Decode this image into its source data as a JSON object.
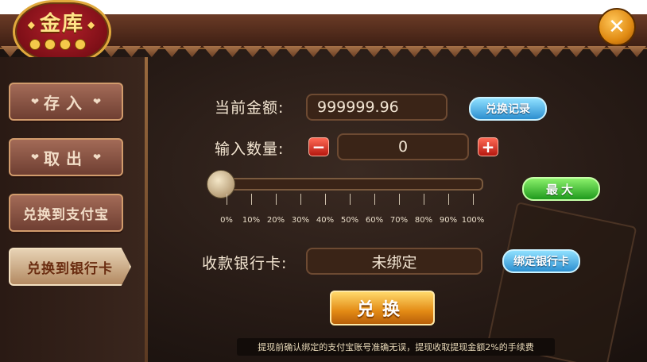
{
  "header": {
    "title": "金库"
  },
  "sidebar": {
    "items": [
      {
        "label": "存入"
      },
      {
        "label": "取出"
      },
      {
        "label": "兑换到支付宝"
      },
      {
        "label": "兑换到银行卡"
      }
    ]
  },
  "form": {
    "balance_label": "当前金额:",
    "balance_value": "999999.96",
    "history_button": "兑换记录",
    "amount_label": "输入数量:",
    "amount_value": "0",
    "max_button": "最大",
    "slider_value": 0,
    "slider_ticks": [
      "0%",
      "10%",
      "20%",
      "30%",
      "40%",
      "50%",
      "60%",
      "70%",
      "80%",
      "90%",
      "100%"
    ],
    "bank_label": "收款银行卡:",
    "bank_value": "未绑定",
    "bind_button": "绑定银行卡",
    "exchange_button": "兑换"
  },
  "notice": "提现前确认绑定的支付宝账号准确无误，提现收取提现金额2%的手续费",
  "colors": {
    "accent": "#e38a14",
    "panel": "#261a15",
    "blue_button": "#2c8fd0",
    "green_button": "#1f9a1d"
  }
}
